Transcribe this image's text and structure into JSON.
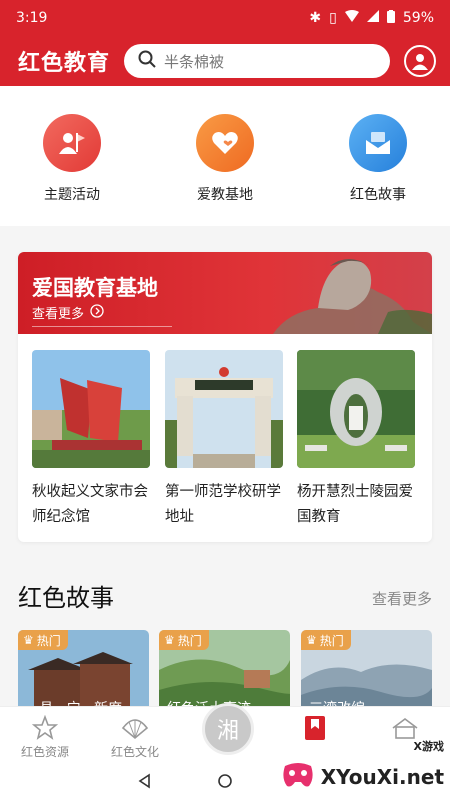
{
  "status": {
    "time": "3:19",
    "battery": "59%"
  },
  "header": {
    "title": "红色教育",
    "search_placeholder": "半条棉被"
  },
  "quick_links": [
    {
      "label": "主题活动",
      "icon": "flag-person-icon",
      "color": "#e9423f"
    },
    {
      "label": "爱教基地",
      "icon": "heart-icon",
      "color": "#f07a2c"
    },
    {
      "label": "红色故事",
      "icon": "mail-icon",
      "color": "#2f8fe0"
    }
  ],
  "banner": {
    "title": "爱国教育基地",
    "more": "查看更多"
  },
  "bases": [
    {
      "caption": "秋收起义文家市会师纪念馆"
    },
    {
      "caption": "第一师范学校研学地址"
    },
    {
      "caption": "杨开慧烈士陵园爱国教育"
    }
  ],
  "section": {
    "title": "红色故事",
    "more": "查看更多"
  },
  "stories": [
    {
      "badge": "热门",
      "title": "...县...宁...新度"
    },
    {
      "badge": "热门",
      "title": "红色泛土事迹"
    },
    {
      "badge": "热门",
      "title": "三湾改编"
    }
  ],
  "tabs": [
    {
      "label": "红色资源",
      "icon": "star-icon"
    },
    {
      "label": "红色文化",
      "icon": "fan-icon"
    },
    {
      "label": "湘",
      "icon": "center-icon"
    },
    {
      "label": "",
      "icon": "bookmark-icon"
    },
    {
      "label": "",
      "icon": "house-icon"
    }
  ],
  "watermark": {
    "text": "XYouXi.net",
    "sub": "X游戏"
  },
  "colors": {
    "primary": "#d8232c",
    "hot_badge": "#e9a14a"
  }
}
